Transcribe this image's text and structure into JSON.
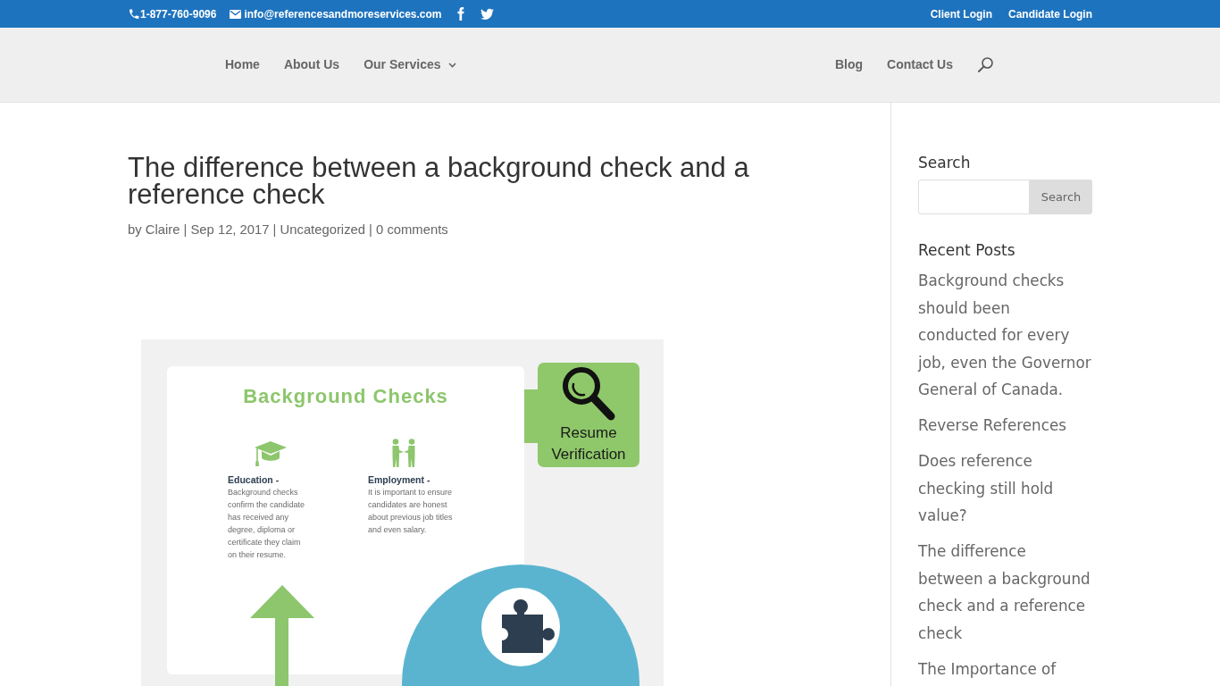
{
  "top_bar": {
    "phone": "1-877-760-9096",
    "email": "info@referencesandmoreservices.com",
    "account_links": [
      "Client Login",
      "Candidate Login"
    ]
  },
  "nav": {
    "left": [
      {
        "label": "Home",
        "has_submenu": false
      },
      {
        "label": "About Us",
        "has_submenu": false
      },
      {
        "label": "Our Services",
        "has_submenu": true
      }
    ],
    "right": [
      {
        "label": "Blog",
        "has_submenu": false
      },
      {
        "label": "Contact Us",
        "has_submenu": false
      }
    ]
  },
  "post": {
    "title": "The difference between a background check and a reference check",
    "meta": {
      "author_prefix": "by",
      "author": "Claire",
      "separators": [
        "|",
        "|",
        "|"
      ],
      "date": "Sep 12, 2017",
      "category": "Uncategorized",
      "comments": "0 comments"
    },
    "infographic": {
      "title": "Background Checks",
      "items": [
        {
          "kind": "education",
          "heading": "Education -",
          "body": "Background checks confirm the candidate has received any degree, diploma or certificate they claim on their resume."
        },
        {
          "kind": "employment",
          "heading": "Employment -",
          "body": "It is important to ensure candidates are honest about previous job titles and even salary."
        }
      ],
      "callout": "Resume Verification"
    }
  },
  "sidebar": {
    "search": {
      "heading": "Search",
      "button": "Search"
    },
    "recent_posts": {
      "heading": "Recent Posts",
      "items": [
        "Background checks should been conducted for every job, even the Governor General of Canada.",
        "Reverse References",
        "Does reference checking still hold value?",
        "The difference between a background check and a reference check",
        "The Importance of"
      ]
    }
  }
}
